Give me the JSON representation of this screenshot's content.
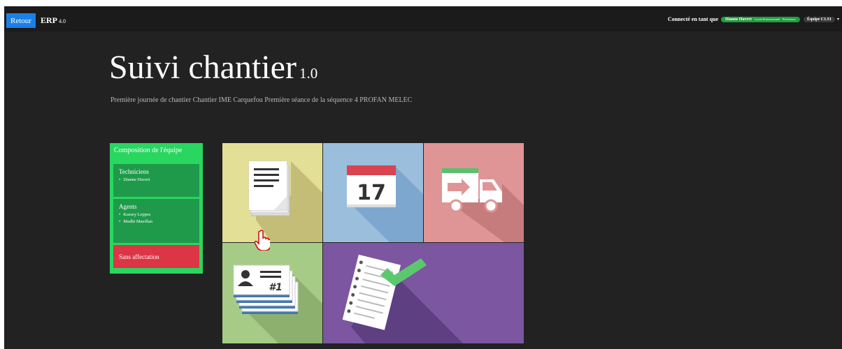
{
  "topbar": {
    "back_label": "Retour",
    "brand": "ERP",
    "brand_version": "4.0",
    "connected_label": "Connecté en tant que",
    "user_name": "Dianne Havert",
    "user_role": "Lycée Professionnel · Professeur",
    "team_label": "Équipe C1.S1"
  },
  "header": {
    "title": "Suivi chantier",
    "version": "1.0",
    "subtitle": "Première journée de chantier Chantier IME Carquefou Première séance de la séquence 4 PROFAN MELEC"
  },
  "team": {
    "title": "Composition de l'équipe",
    "groups": [
      {
        "label": "Techniciens",
        "members": [
          "Dianne Havert"
        ]
      },
      {
        "label": "Agents",
        "members": [
          "Kassey Leppes",
          "Madhi Maeillan"
        ]
      }
    ],
    "unassigned_label": "Sans affectation"
  },
  "tiles": {
    "documents": {
      "icon": "document-stack-icon"
    },
    "calendar": {
      "icon": "calendar-icon",
      "day": "17"
    },
    "delivery": {
      "icon": "truck-icon"
    },
    "staff": {
      "icon": "staff-cards-icon",
      "badge": "#1"
    },
    "checklist": {
      "icon": "checklist-icon"
    }
  },
  "colors": {
    "accent_blue": "#1b80e6",
    "team_green": "#29d660",
    "unassigned_red": "#dc3545",
    "tile_documents": "#e3df96",
    "tile_calendar": "#9bbedd",
    "tile_delivery": "#df9595",
    "tile_staff": "#a6cb86",
    "tile_checklist": "#7c56a0"
  }
}
